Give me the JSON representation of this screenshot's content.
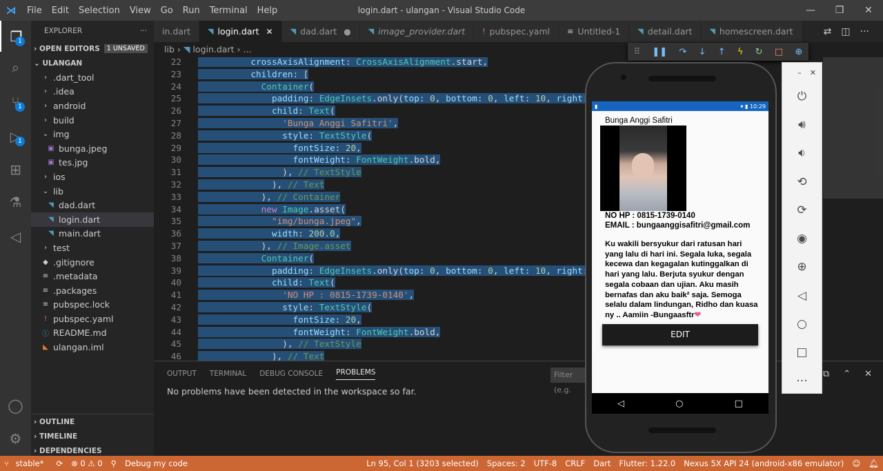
{
  "titlebar": {
    "menus": [
      "File",
      "Edit",
      "Selection",
      "View",
      "Go",
      "Run",
      "Terminal",
      "Help"
    ],
    "title": "login.dart - ulangan - Visual Studio Code"
  },
  "sidebar": {
    "header": "EXPLORER",
    "open_editors": "OPEN EDITORS",
    "unsaved": "1 UNSAVED",
    "root": "ULANGAN",
    "items": [
      {
        "label": ".dart_tool",
        "icon": "›",
        "indent": 1
      },
      {
        "label": ".idea",
        "icon": "›",
        "indent": 1
      },
      {
        "label": "android",
        "icon": "›",
        "indent": 1
      },
      {
        "label": "build",
        "icon": "›",
        "indent": 1
      },
      {
        "label": "img",
        "icon": "⌄",
        "indent": 1
      },
      {
        "label": "bunga.jpeg",
        "icon": "▣",
        "indent": 2
      },
      {
        "label": "tes.jpg",
        "icon": "▣",
        "indent": 2
      },
      {
        "label": "ios",
        "icon": "›",
        "indent": 1
      },
      {
        "label": "lib",
        "icon": "⌄",
        "indent": 1
      },
      {
        "label": "dad.dart",
        "icon": "◥",
        "indent": 2
      },
      {
        "label": "login.dart",
        "icon": "◥",
        "indent": 2
      },
      {
        "label": "main.dart",
        "icon": "◥",
        "indent": 2
      },
      {
        "label": "test",
        "icon": "›",
        "indent": 1
      },
      {
        "label": ".gitignore",
        "icon": "◆",
        "indent": 1
      },
      {
        "label": ".metadata",
        "icon": "≡",
        "indent": 1
      },
      {
        "label": ".packages",
        "icon": "≡",
        "indent": 1
      },
      {
        "label": "pubspec.lock",
        "icon": "≡",
        "indent": 1
      },
      {
        "label": "pubspec.yaml",
        "icon": "!",
        "indent": 1
      },
      {
        "label": "README.md",
        "icon": "ⓘ",
        "indent": 1
      },
      {
        "label": "ulangan.iml",
        "icon": "◣",
        "indent": 1
      }
    ],
    "outline": "OUTLINE",
    "timeline": "TIMELINE",
    "dependencies": "DEPENDENCIES"
  },
  "tabs": [
    {
      "label": "in.dart",
      "icon": "",
      "close": ""
    },
    {
      "label": "login.dart",
      "icon": "◥",
      "close": "✕"
    },
    {
      "label": "dad.dart",
      "icon": "◥",
      "close": "●"
    },
    {
      "label": "image_provider.dart",
      "icon": "◥",
      "close": ""
    },
    {
      "label": "pubspec.yaml",
      "icon": "!",
      "close": ""
    },
    {
      "label": "Untitled-1",
      "icon": "≡",
      "close": ""
    },
    {
      "label": "detail.dart",
      "icon": "◥",
      "close": ""
    },
    {
      "label": "homescreen.dart",
      "icon": "◥",
      "close": ""
    }
  ],
  "breadcrumb": {
    "a": "lib",
    "b": "login.dart",
    "c": "..."
  },
  "code_lines": [
    {
      "n": "22",
      "html": "<span class='hl'>          <span class='k'>crossAxisAlignment</span>: <span class='t'>CrossAxisAlignment</span>.start,</span>"
    },
    {
      "n": "23",
      "html": "<span class='hl'>          <span class='k'>children</span>: [</span>"
    },
    {
      "n": "24",
      "html": "<span class='hl'>            <span class='t'>Container</span>(</span>"
    },
    {
      "n": "25",
      "html": "<span class='hl'>              <span class='k'>padding</span>: <span class='t'>EdgeInsets</span>.only(<span class='k'>top</span>: <span class='n'>0</span>, <span class='k'>bottom</span>: <span class='n'>0</span>, <span class='k'>left</span>: <span class='n'>10</span>, <span class='k'>right</span>: <span class='n'>0</span>),</span>"
    },
    {
      "n": "26",
      "html": "<span class='hl'>              <span class='k'>child</span>: <span class='t'>Text</span>(</span>"
    },
    {
      "n": "27",
      "html": "<span class='hl'>                <span class='s'>'Bunga Anggi Safitri'</span>,</span>"
    },
    {
      "n": "28",
      "html": "<span class='hl'>                <span class='k'>style</span>: <span class='t'>TextStyle</span>(</span>"
    },
    {
      "n": "29",
      "html": "<span class='hl'>                  <span class='k'>fontSize</span>: <span class='n'>20</span>,</span>"
    },
    {
      "n": "30",
      "html": "<span class='hl'>                  <span class='k'>fontWeight</span>: <span class='t'>FontWeight</span>.bold,</span>"
    },
    {
      "n": "31",
      "html": "<span class='hl'>                ), <span class='c'>// TextStyle</span></span>"
    },
    {
      "n": "32",
      "html": "<span class='hl'>              ), <span class='c'>// Text</span></span>"
    },
    {
      "n": "33",
      "html": "<span class='hl'>            ), <span class='c'>// Container</span></span>"
    },
    {
      "n": "34",
      "html": "<span class='hl'>            <span class='kw'>new</span> <span class='t'>Image</span>.asset(</span>"
    },
    {
      "n": "35",
      "html": "<span class='hl'>              <span class='s'>\"img/bunga.jpeg\"</span>,</span>"
    },
    {
      "n": "36",
      "html": "<span class='hl'>              <span class='k'>width</span>: <span class='n'>200.0</span>,</span>"
    },
    {
      "n": "37",
      "html": "<span class='hl'>            ), <span class='c'>// Image.asset</span></span>"
    },
    {
      "n": "38",
      "html": "<span class='hl'>            <span class='t'>Container</span>(</span>"
    },
    {
      "n": "39",
      "html": "<span class='hl'>              <span class='k'>padding</span>: <span class='t'>EdgeInsets</span>.only(<span class='k'>top</span>: <span class='n'>0</span>, <span class='k'>bottom</span>: <span class='n'>0</span>, <span class='k'>left</span>: <span class='n'>10</span>, <span class='k'>right</span>: <span class='n'>0</span>),</span>"
    },
    {
      "n": "40",
      "html": "<span class='hl'>              <span class='k'>child</span>: <span class='t'>Text</span>(</span>"
    },
    {
      "n": "41",
      "html": "<span class='hl'>                <span class='s'>'NO HP : 0815-1739-0140'</span>,</span>"
    },
    {
      "n": "42",
      "html": "<span class='hl'>                <span class='k'>style</span>: <span class='t'>TextStyle</span>(</span>"
    },
    {
      "n": "43",
      "html": "<span class='hl'>                  <span class='k'>fontSize</span>: <span class='n'>20</span>,</span>"
    },
    {
      "n": "44",
      "html": "<span class='hl'>                  <span class='k'>fontWeight</span>: <span class='t'>FontWeight</span>.bold,</span>"
    },
    {
      "n": "45",
      "html": "<span class='hl'>                ), <span class='c'>// TextStyle</span></span>"
    },
    {
      "n": "46",
      "html": "<span class='hl'>              ), <span class='c'>// Text</span></span>"
    }
  ],
  "panel": {
    "tabs": [
      "OUTPUT",
      "TERMINAL",
      "DEBUG CONSOLE",
      "PROBLEMS"
    ],
    "active": "PROBLEMS",
    "filter": "Filter (e.g.",
    "message": "No problems have been detected in the workspace so far."
  },
  "phone": {
    "time": "10:29",
    "name": "Bunga Anggi Safitri",
    "phone_line": "NO HP : 0815-1739-0140",
    "email_line": "EMAIL :  bungaanggisafitri@gmail.com",
    "quote": "Ku wakili bersyukur dari ratusan hari yang lalu di hari ini. Segala luka, segala kecewa dan kegagalan kutinggalkan di hari yang lalu. Berjuta syukur dengan segala cobaan dan ujian. Aku masih bernafas dan aku baik² saja. Semoga selalu dalam lindungan, Ridho dan kuasa ny .. Aamiin -Bungaasftr",
    "edit": "EDIT"
  },
  "statusbar": {
    "branch": "stable*",
    "errors": "⊗ 0 ⚠ 0",
    "debug": "Debug my code",
    "position": "Ln 95, Col 1 (3203 selected)",
    "spaces": "Spaces: 2",
    "encoding": "UTF-8",
    "eol": "CRLF",
    "lang": "Dart",
    "flutter": "Flutter: 1.22.0",
    "device": "Nexus 5X API 24 (android-x86 emulator)"
  },
  "colors": {
    "statusbar": "#cc6633",
    "accent": "#0e7cd6"
  }
}
